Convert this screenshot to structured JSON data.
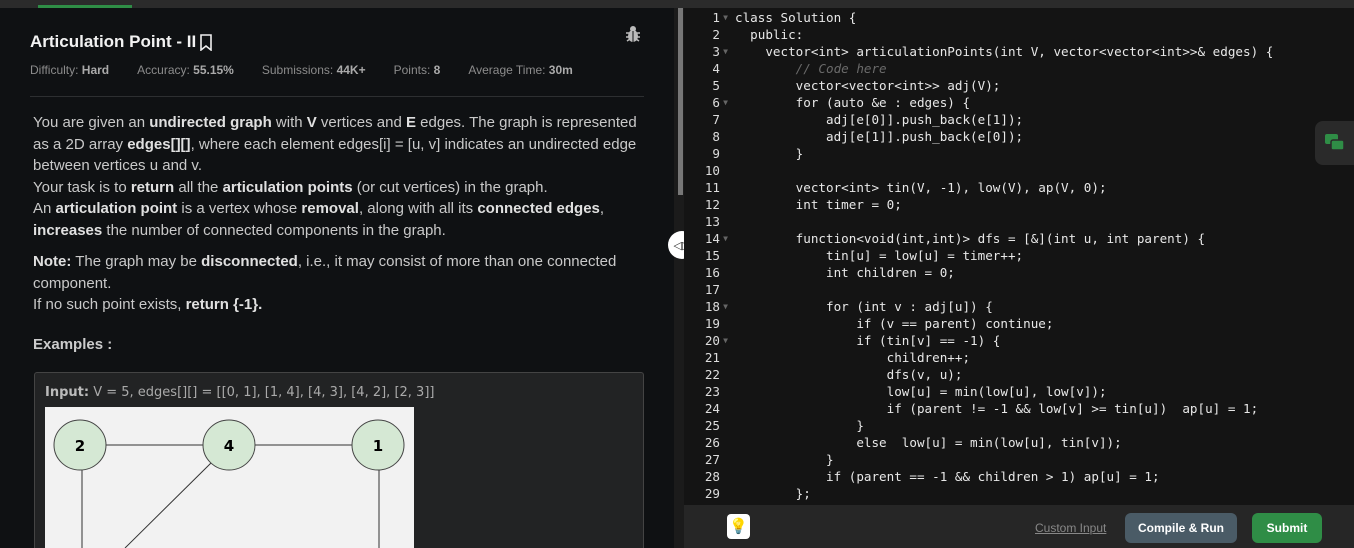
{
  "problem": {
    "title": "Articulation Point - II",
    "stats": [
      {
        "label": "Difficulty: ",
        "value": "Hard"
      },
      {
        "label": "Accuracy: ",
        "value": "55.15%"
      },
      {
        "label": "Submissions: ",
        "value": "44K+"
      },
      {
        "label": "Points: ",
        "value": "8"
      },
      {
        "label": "Average Time: ",
        "value": "30m"
      }
    ],
    "paragraphs": [
      [
        [
          {
            "t": "You are given an "
          },
          {
            "t": "undirected graph",
            "b": true
          },
          {
            "t": " with "
          },
          {
            "t": "V",
            "b": true
          },
          {
            "t": " vertices and "
          },
          {
            "t": "E",
            "b": true
          },
          {
            "t": " edges. The graph is represented as a 2D array "
          },
          {
            "t": "edges[][]",
            "b": true
          },
          {
            "t": ", where each element edges[i] = [u, v] indicates an undirected edge between vertices u and v."
          }
        ],
        [
          {
            "t": "Your task is to "
          },
          {
            "t": "return",
            "b": true
          },
          {
            "t": " all the "
          },
          {
            "t": "articulation points",
            "b": true
          },
          {
            "t": " (or cut vertices) in the graph."
          }
        ],
        [
          {
            "t": "An "
          },
          {
            "t": "articulation point",
            "b": true
          },
          {
            "t": " is a vertex whose "
          },
          {
            "t": "removal",
            "b": true
          },
          {
            "t": ", along with all its "
          },
          {
            "t": "connected edges",
            "b": true
          },
          {
            "t": ", "
          },
          {
            "t": "increases",
            "b": true
          },
          {
            "t": " the number of connected components in the graph."
          }
        ]
      ],
      [
        [
          {
            "t": "Note:",
            "b": true
          },
          {
            "t": " The graph may be "
          },
          {
            "t": "disconnected",
            "b": true
          },
          {
            "t": ", i.e., it may consist of more than one connected component."
          }
        ],
        [
          {
            "t": "If no such point exists, "
          },
          {
            "t": "return {-1}.",
            "b": true
          }
        ]
      ]
    ],
    "examples_heading": "Examples :",
    "example": {
      "input_label": "Input:",
      "input_value": " V = 5, edges[][] = [[0, 1], [1, 4], [4, 3], [4, 2], [2, 3]]",
      "graph_nodes": [
        "2",
        "4",
        "1"
      ]
    }
  },
  "editor": {
    "lines": [
      "class Solution {",
      "  public:",
      "    vector<int> articulationPoints(int V, vector<vector<int>>& edges) {",
      "        // Code here",
      "        vector<vector<int>> adj(V);",
      "        for (auto &e : edges) {",
      "            adj[e[0]].push_back(e[1]);",
      "            adj[e[1]].push_back(e[0]);",
      "        }",
      "",
      "        vector<int> tin(V, -1), low(V), ap(V, 0);",
      "        int timer = 0;",
      "",
      "        function<void(int,int)> dfs = [&](int u, int parent) {",
      "            tin[u] = low[u] = timer++;",
      "            int children = 0;",
      "",
      "            for (int v : adj[u]) {",
      "                if (v == parent) continue;",
      "                if (tin[v] == -1) {",
      "                    children++;",
      "                    dfs(v, u);",
      "                    low[u] = min(low[u], low[v]);",
      "                    if (parent != -1 && low[v] >= tin[u])  ap[u] = 1;",
      "                }",
      "                else  low[u] = min(low[u], tin[v]);",
      "            }",
      "            if (parent == -1 && children > 1) ap[u] = 1;",
      "        };"
    ],
    "foldable": [
      1,
      3,
      6,
      14,
      18,
      20
    ]
  },
  "footer": {
    "custom_input": "Custom Input",
    "compile_run": "Compile & Run",
    "submit": "Submit"
  },
  "colors": {
    "accent": "#2f8d46",
    "compile": "#4a5b66"
  }
}
